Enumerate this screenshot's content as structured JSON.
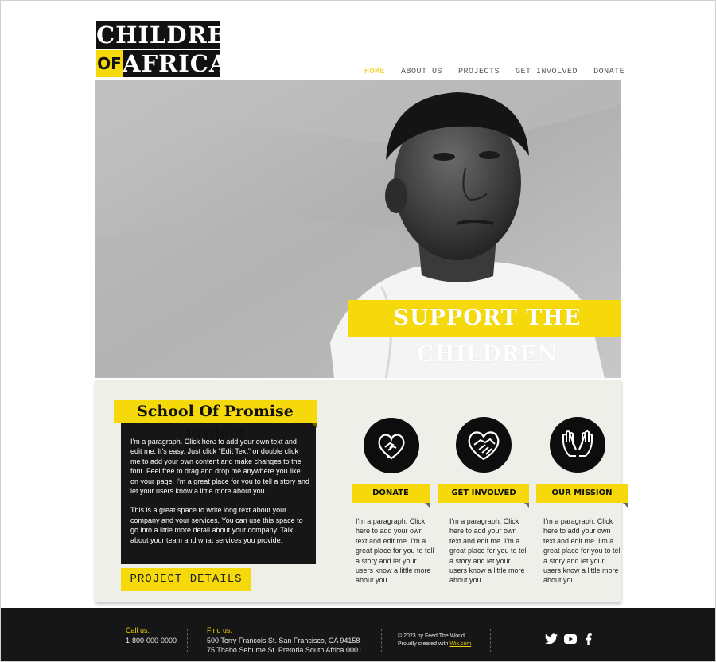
{
  "logo": {
    "line1": "CHILDREN",
    "of": "OF",
    "line2": "AFRICA"
  },
  "nav": {
    "items": [
      "HOME",
      "ABOUT US",
      "PROJECTS",
      "GET INVOLVED",
      "DONATE"
    ],
    "active": "HOME"
  },
  "hero": {
    "banner": "SUPPORT THE CHILDREN"
  },
  "project": {
    "title": "School Of Promise Project",
    "paragraph1": "I'm a paragraph. Click here to add your own text and edit me. It's easy. Just click “Edit Text” or double click me to add your own content and make changes to the font. Feel free to drag and drop me anywhere you like on your page. I'm a great place for you to tell a story and let your users know a little more about you.",
    "paragraph2": "This is a great space to write long text about your company and your services. You can use this space to go into a little more detail about your company. Talk about your team and what services you provide.",
    "button": "PROJECT DETAILS"
  },
  "columns": [
    {
      "label": "DONATE",
      "icon": "heart-hand-icon",
      "text": "I'm a paragraph. Click here to add your own text and edit me. I'm a great place for you to tell a story and let your users know a little more about you."
    },
    {
      "label": "GET INVOLVED",
      "icon": "handshake-heart-icon",
      "text": "I'm a paragraph. Click here to add your own text and edit me. I'm a great place for you to tell a story and let your users know a little more about you."
    },
    {
      "label": "OUR MISSION",
      "icon": "open-hands-icon",
      "text": "I'm a paragraph. Click here to add your own text and edit me. I'm a great place for you to tell a story and let your users know a little more about you."
    }
  ],
  "footer": {
    "call_label": "Call us:",
    "phone": "1-800-000-0000",
    "find_label": "Find us:",
    "address1": "500 Terry Francois St. San Francisco, CA 94158",
    "address2": "75 Thabo Sehume St. Pretoria South Africa 0001",
    "copyright": "© 2023 by Feed The World.",
    "created_prefix": "Proudly created with",
    "created_link": "Wix.com",
    "social": [
      "twitter-icon",
      "youtube-icon",
      "facebook-icon"
    ]
  },
  "colors": {
    "accent": "#f5d90a",
    "dark": "#161616",
    "section_bg": "#efefea"
  }
}
